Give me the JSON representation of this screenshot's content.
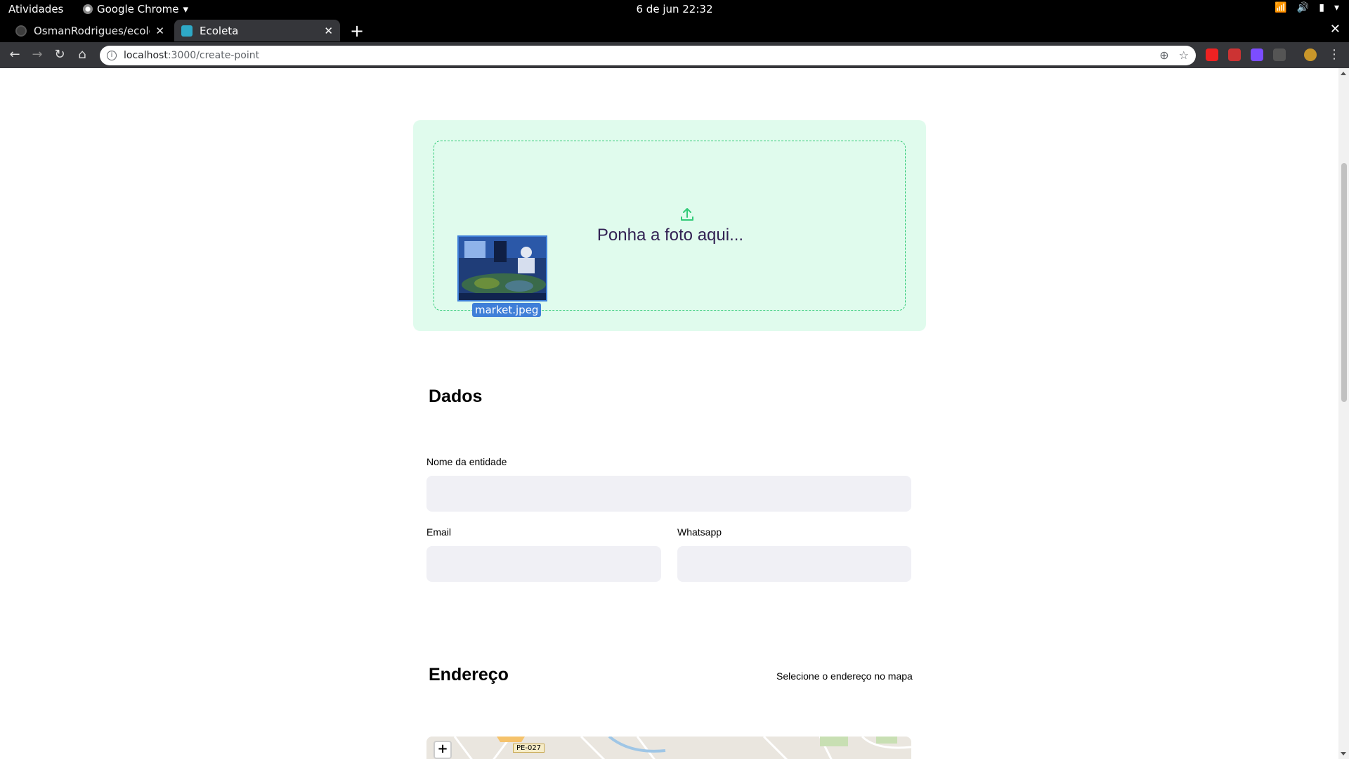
{
  "system": {
    "activities": "Atividades",
    "app_name": "Google Chrome",
    "clock": "6 de jun  22:32"
  },
  "tabs": [
    {
      "title": "OsmanRodrigues/ecoleta"
    },
    {
      "title": "Ecoleta"
    }
  ],
  "address_bar": {
    "host": "localhost",
    "path": ":3000/create-point"
  },
  "dropzone": {
    "prompt": "Ponha a foto aqui..."
  },
  "drag": {
    "file_name": "market.jpeg"
  },
  "dados": {
    "title": "Dados",
    "name_label": "Nome da entidade",
    "email_label": "Email",
    "whatsapp_label": "Whatsapp"
  },
  "endereco": {
    "title": "Endereço",
    "hint": "Selecione o endereço no mapa",
    "zoom_in": "+",
    "road_label": "PE-027"
  },
  "colors": {
    "accent": "#34cb79",
    "dropzone_bg": "#e0fbed",
    "field_bg": "#f0f0f5"
  }
}
